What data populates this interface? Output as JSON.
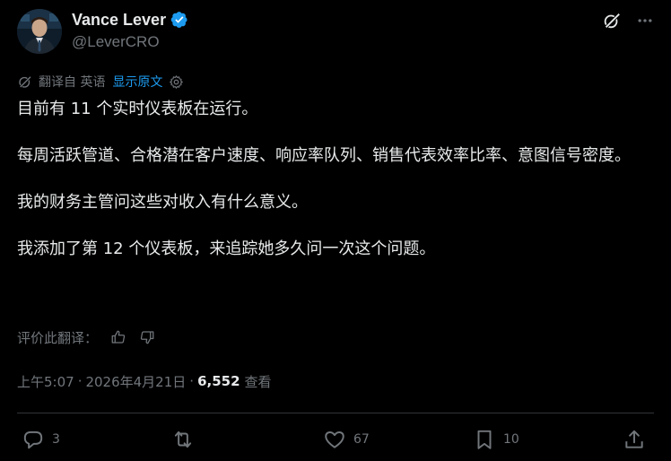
{
  "author": {
    "display_name": "Vance Lever",
    "handle": "@LeverCRO",
    "verified": true
  },
  "colors": {
    "background": "#000000",
    "text": "#e7e9ea",
    "muted": "#71767b",
    "link": "#1d9bf0",
    "verified": "#1d9bf0",
    "divider": "#2f3336"
  },
  "icons": {
    "header": [
      "grok-icon",
      "more-icon"
    ],
    "translate": [
      "globe-icon",
      "gear-icon"
    ],
    "rating": [
      "thumbs-up-icon",
      "thumbs-down-icon"
    ],
    "actions": [
      "reply-icon",
      "retweet-icon",
      "like-icon",
      "bookmark-icon",
      "share-icon"
    ]
  },
  "translation": {
    "label": "翻译自 英语",
    "show_original": "显示原文"
  },
  "tweet": {
    "paragraphs": [
      "目前有 11 个实时仪表板在运行。",
      "每周活跃管道、合格潜在客户速度、响应率队列、销售代表效率比率、意图信号密度。",
      "我的财务主管问这些对收入有什么意义。",
      "我添加了第 12 个仪表板，来追踪她多久问一次这个问题。"
    ]
  },
  "rating": {
    "label": "评价此翻译："
  },
  "meta": {
    "time": "上午5:07",
    "separator": "·",
    "date": "2026年4月21日",
    "views": "6,552",
    "views_label": "查看"
  },
  "actions": {
    "replies": "3",
    "retweets": "",
    "likes": "67",
    "bookmarks": "10"
  }
}
